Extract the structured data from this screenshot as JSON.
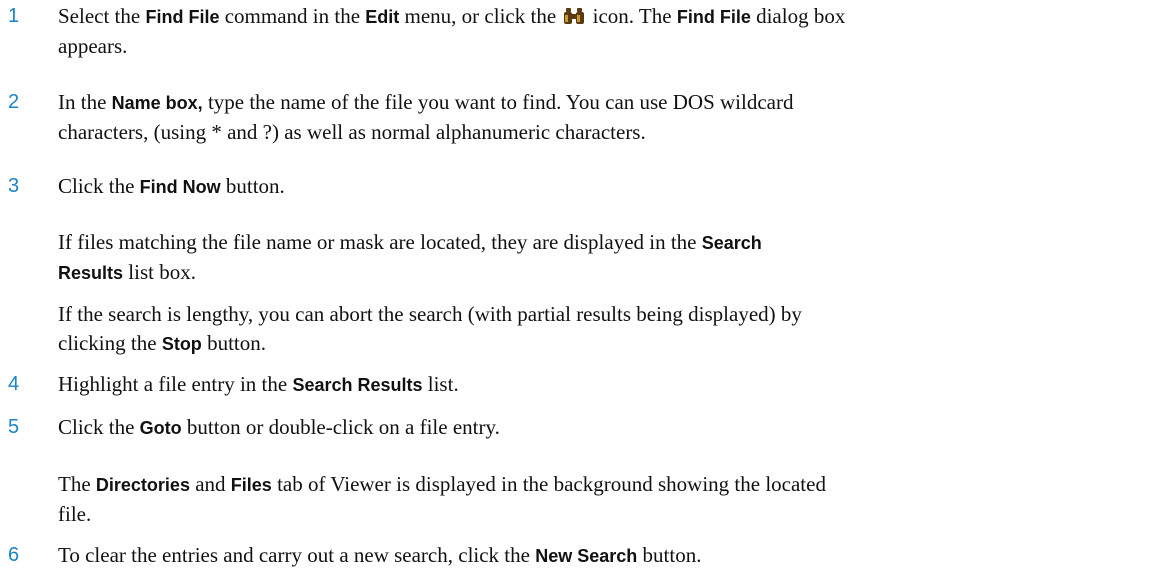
{
  "steps": [
    {
      "num": "1",
      "pre": "Select the ",
      "b1": "Find File",
      "mid1": " command in the ",
      "b2": "Edit",
      "mid2": " menu, or click the ",
      "icon": "binoculars-icon",
      "mid3": " icon. The ",
      "b3": "Find File",
      "post": " dialog box",
      "line2": "appears."
    },
    {
      "num": "2",
      "pre": "In the ",
      "b1": "Name box,",
      "post": " type the name of the file you want to find. You can use DOS wildcard",
      "line2": "characters, (using * and ?) as well as normal alphanumeric characters."
    },
    {
      "num": "3",
      "pre": "Click the ",
      "b1": "Find Now",
      "post": " button."
    },
    {
      "num": "4",
      "pre": "Highlight a file entry in the ",
      "b1": "Search Results",
      "post": " list."
    },
    {
      "num": "5",
      "pre": "Click the ",
      "b1": "Goto",
      "post": " button or double-click on a file entry."
    },
    {
      "num": "6",
      "pre": "To clear the entries and carry out a new search, click the ",
      "b1": "New Search",
      "post": " button."
    }
  ],
  "paragraphs": {
    "p3a_pre": "If files matching the file name or mask are located, they are displayed in the ",
    "p3a_b": "Search",
    "p3a_b2": "Results",
    "p3a_post": " list box.",
    "p3b_pre": "If the search is lengthy, you can abort the search (with partial results being displayed) by",
    "p3b_l2pre": "clicking the ",
    "p3b_b": "Stop",
    "p3b_post": " button.",
    "p5a_b1": "Directories",
    "p5a_mid": " and ",
    "p5a_b2": "Files",
    "p5a_post": " tab of Viewer is displayed in the background showing the located",
    "p5a_pre": "The ",
    "p5a_l2": "file."
  },
  "colors": {
    "step_number": "#1a84c4",
    "text": "#111111"
  }
}
